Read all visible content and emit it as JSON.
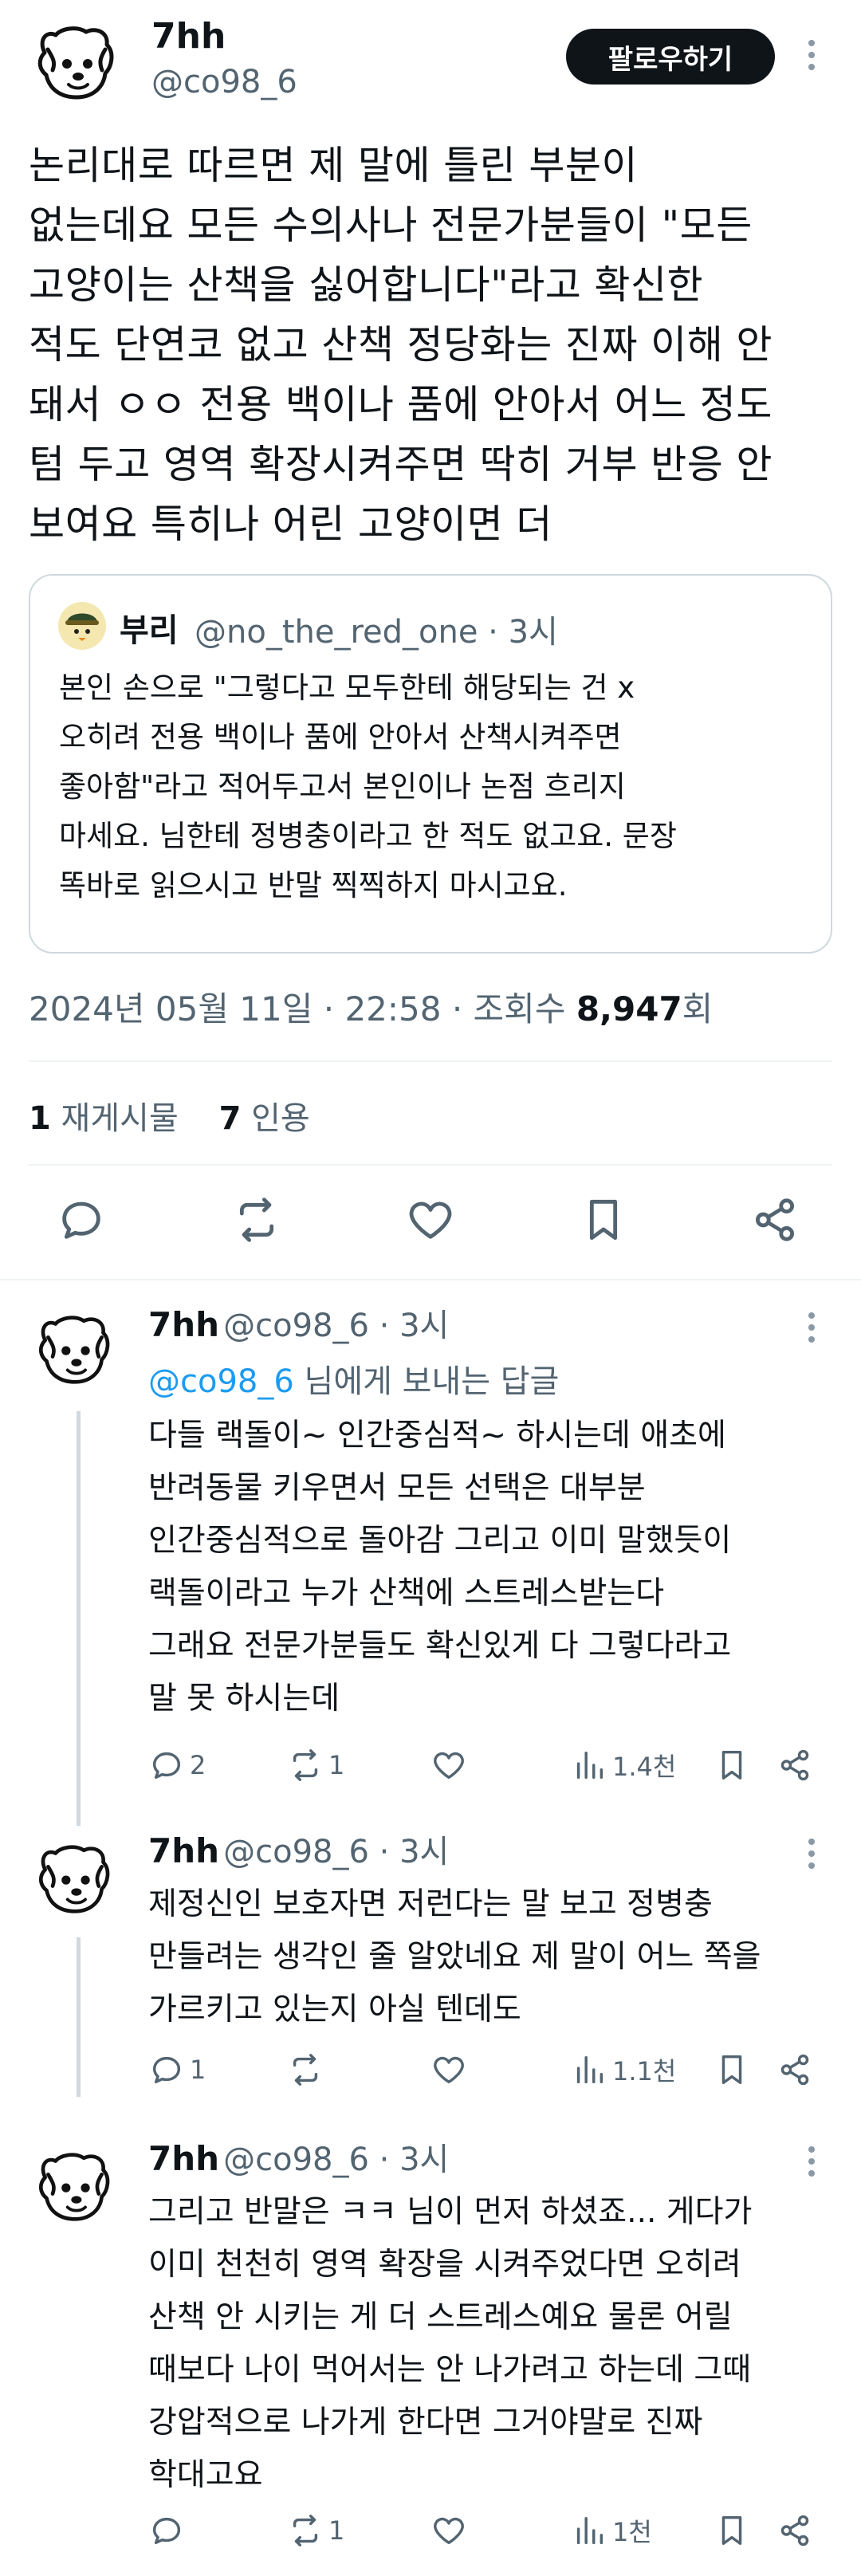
{
  "main_tweet": {
    "author_name": "7hh",
    "author_handle": "@co98_6",
    "follow_label": "팔로우하기",
    "body_lines": [
      "논리대로 따르면 제 말에 틀린 부분이",
      "없는데요 모든 수의사나 전문가분들이 \"모든",
      "고양이는 산책을 싫어합니다\"라고 확신한",
      "적도 단연코 없고 산책 정당화는 진짜 이해 안",
      "돼서 ㅇㅇ 전용 백이나 품에 안아서 어느 정도",
      "텀 두고 영역 확장시켜주면 딱히 거부 반응 안",
      "보여요 특히나 어린 고양이면 더"
    ],
    "quote": {
      "author_name": "부리",
      "author_handle": "@no_the_red_one · 3시",
      "body_lines": [
        "본인 손으로 \"그렇다고 모두한테 해당되는 건 x",
        "오히려 전용 백이나 품에 안아서 산책시켜주면",
        "좋아함\"라고 적어두고서 본인이나 논점 흐리지",
        "마세요. 님한테 정병충이라고 한 적도 없고요. 문장",
        "똑바로 읽으시고 반말 찍찍하지 마시고요."
      ]
    },
    "timestamp": "2024년 05월 11일 · 22:58 · 조회수 ",
    "views": "8,947",
    "views_suffix": "회",
    "retweet_count": "1",
    "retweet_label": " 재게시물",
    "quote_count": "7",
    "quote_label": " 인용"
  },
  "replies": [
    {
      "author_name": "7hh",
      "author_handle": "@co98_6 · 3시",
      "reply_to_handle": "@co98_6",
      "reply_to_suffix": " 님에게 보내는 답글",
      "body_lines": [
        "다들 랙돌이~ 인간중심적~ 하시는데 애초에",
        "반려동물 키우면서 모든 선택은 대부분",
        "인간중심적으로 돌아감 그리고 이미 말했듯이",
        "랙돌이라고 누가 산책에 스트레스받는다",
        "그래요 전문가분들도 확신있게 다 그렇다라고",
        "말 못 하시는데"
      ],
      "replies": "2",
      "retweets": "1",
      "likes": "",
      "views": "1.4천"
    },
    {
      "author_name": "7hh",
      "author_handle": "@co98_6 · 3시",
      "body_lines": [
        "제정신인 보호자면 저런다는 말 보고 정병충",
        "만들려는 생각인 줄 알았네요 제 말이 어느 쪽을",
        "가르키고 있는지 아실 텐데도"
      ],
      "replies": "1",
      "retweets": "",
      "likes": "",
      "views": "1.1천"
    },
    {
      "author_name": "7hh",
      "author_handle": "@co98_6 · 3시",
      "body_lines": [
        "그리고 반말은 ㅋㅋ 님이 먼저 하셨죠... 게다가",
        "이미 천천히 영역 확장을 시켜주었다면 오히려",
        "산책 안 시키는 게 더 스트레스예요 물론 어릴",
        "때보다 나이 먹어서는 안 나가려고 하는데 그때",
        "강압적으로 나가게 한다면 그거야말로 진짜",
        "학대고요"
      ],
      "replies": "",
      "retweets": "1",
      "likes": "",
      "views": "1천"
    }
  ],
  "icons": [
    "dog-avatar-icon",
    "more-icon",
    "reply-icon",
    "retweet-icon",
    "like-icon",
    "bookmark-icon",
    "share-icon",
    "views-icon"
  ]
}
